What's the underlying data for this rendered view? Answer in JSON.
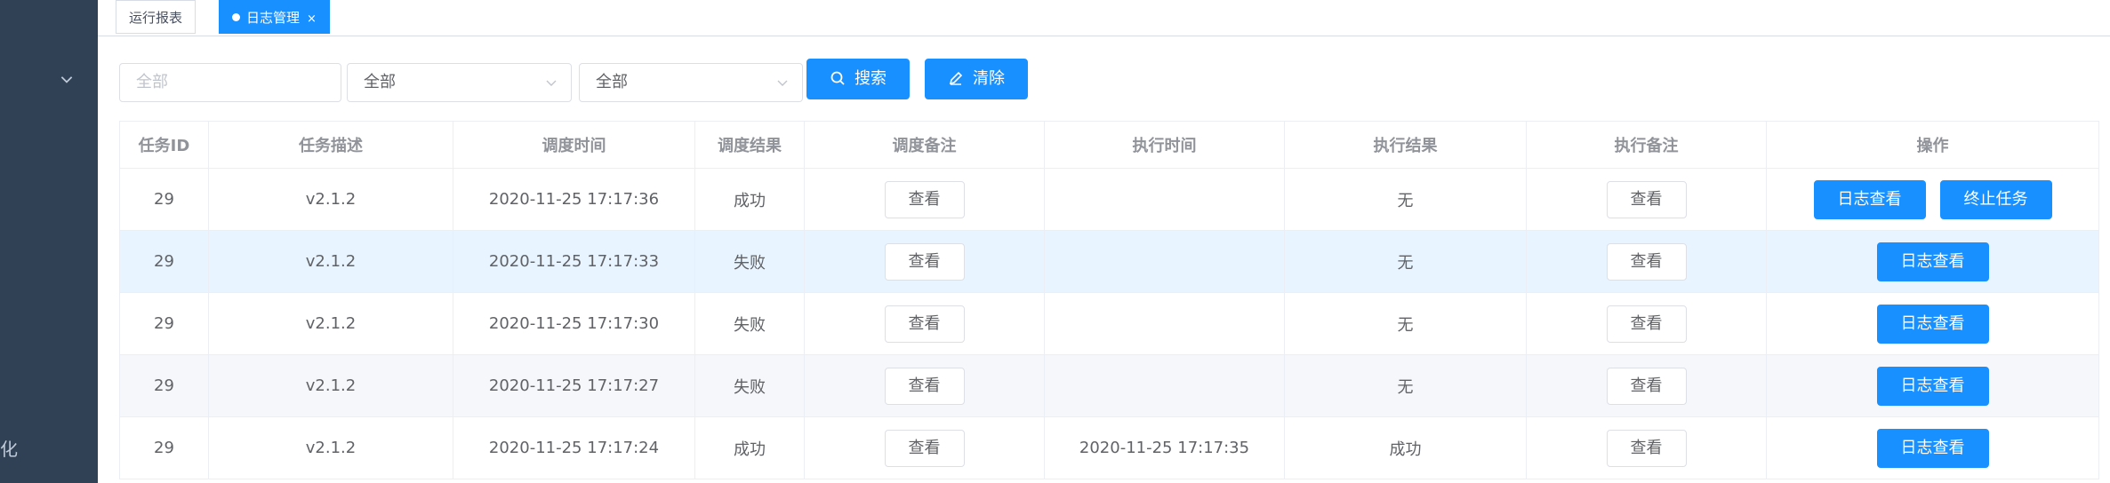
{
  "sidebar": {
    "chevron_icon": "chevron-down-icon",
    "partial_item_label": "化"
  },
  "tabs": [
    {
      "label": "运行报表",
      "active": false
    },
    {
      "label": "日志管理",
      "active": true,
      "close": "×"
    }
  ],
  "filters": {
    "task_id": {
      "value": "",
      "placeholder": "全部"
    },
    "select1": {
      "value": "全部"
    },
    "select2": {
      "value": "全部"
    }
  },
  "buttons": {
    "search": "搜索",
    "clear": "清除"
  },
  "table": {
    "headers": [
      "任务ID",
      "任务描述",
      "调度时间",
      "调度结果",
      "调度备注",
      "执行时间",
      "执行结果",
      "执行备注",
      "操作"
    ],
    "view_label": "查看",
    "log_label": "日志查看",
    "stop_label": "终止任务",
    "rows": [
      {
        "id": "29",
        "desc": "v2.1.2",
        "schedule_time": "2020-11-25 17:17:36",
        "schedule_result": "成功",
        "exec_time": "",
        "exec_result": "无"
      },
      {
        "id": "29",
        "desc": "v2.1.2",
        "schedule_time": "2020-11-25 17:17:33",
        "schedule_result": "失败",
        "exec_time": "",
        "exec_result": "无"
      },
      {
        "id": "29",
        "desc": "v2.1.2",
        "schedule_time": "2020-11-25 17:17:30",
        "schedule_result": "失败",
        "exec_time": "",
        "exec_result": "无"
      },
      {
        "id": "29",
        "desc": "v2.1.2",
        "schedule_time": "2020-11-25 17:17:27",
        "schedule_result": "失败",
        "exec_time": "",
        "exec_result": "无"
      },
      {
        "id": "29",
        "desc": "v2.1.2",
        "schedule_time": "2020-11-25 17:17:24",
        "schedule_result": "成功",
        "exec_time": "2020-11-25 17:17:35",
        "exec_result": "成功"
      }
    ]
  },
  "colors": {
    "primary": "#1890ff",
    "sidebar": "#304156",
    "fail": "#f5222d",
    "highlight_row": "#e8f4ff"
  }
}
